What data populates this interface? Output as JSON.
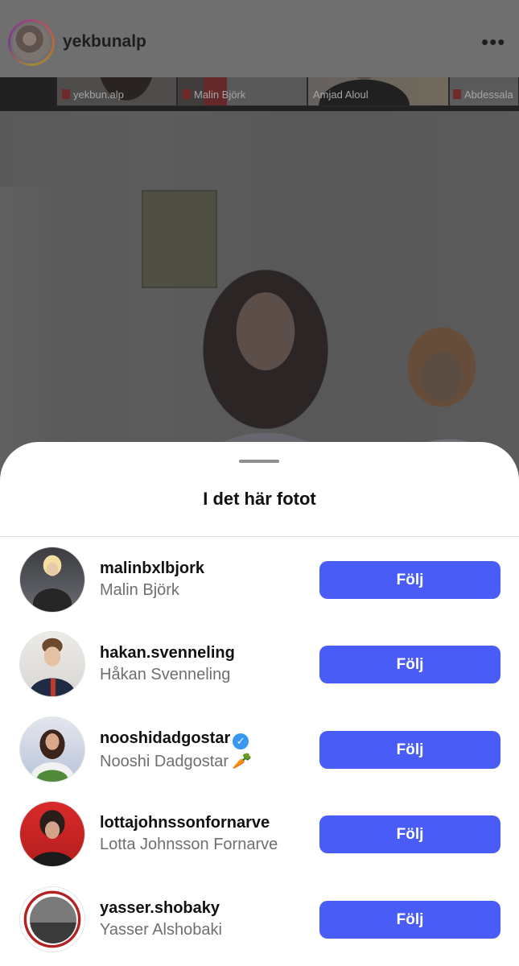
{
  "post": {
    "username": "yekbunalp",
    "more_icon": "more-horizontal-icon",
    "video_tiles": [
      {
        "label": "yekbun.alp"
      },
      {
        "label": "Malin Björk"
      },
      {
        "label": "Amjad Aloul"
      },
      {
        "label": "Abdessala"
      }
    ]
  },
  "sheet": {
    "title": "I det här fotot",
    "people": [
      {
        "username": "malinbxlbjork",
        "full_name": "Malin Björk",
        "verified": false,
        "button": "Följ"
      },
      {
        "username": "hakan.svenneling",
        "full_name": "Håkan Svenneling",
        "verified": false,
        "button": "Följ"
      },
      {
        "username": "nooshidadgostar",
        "full_name": "Nooshi Dadgostar",
        "full_name_emoji": "🥕",
        "verified": true,
        "button": "Följ"
      },
      {
        "username": "lottajohnssonfornarve",
        "full_name": "Lotta Johnsson Fornarve",
        "verified": false,
        "button": "Följ"
      },
      {
        "username": "yasser.shobaky",
        "full_name": "Yasser Alshobaki",
        "verified": false,
        "button": "Följ"
      }
    ]
  },
  "colors": {
    "follow_button": "#4a5cf6",
    "verified_badge": "#3897f0",
    "sheet_background": "#ffffff"
  }
}
